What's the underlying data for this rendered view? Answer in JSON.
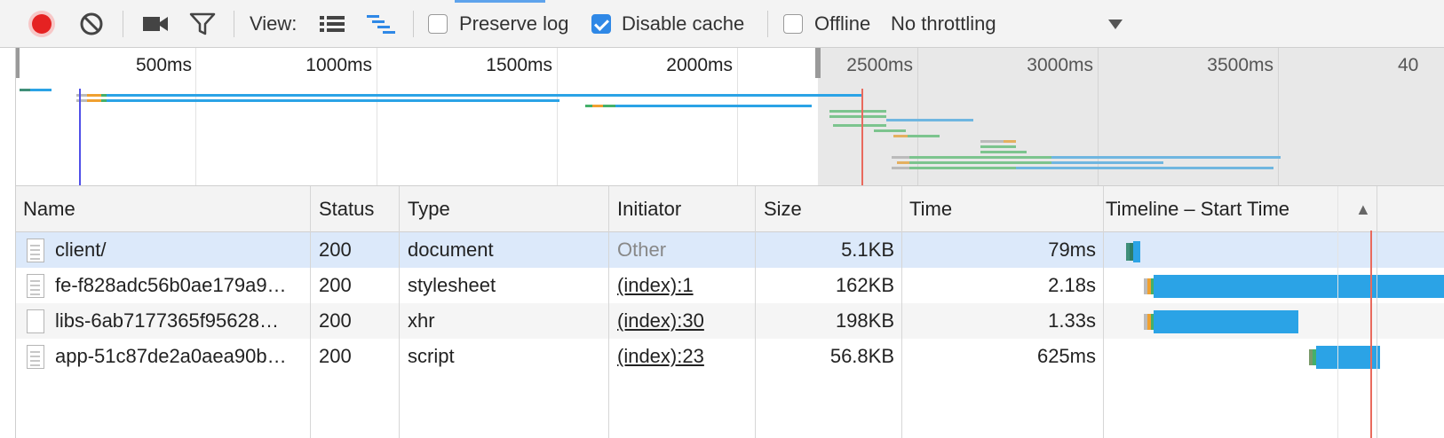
{
  "toolbar": {
    "record_icon": "record-icon",
    "clear_icon": "clear-icon",
    "view_label": "View:",
    "preserve_log_label": "Preserve log",
    "preserve_log_checked": false,
    "disable_cache_label": "Disable cache",
    "disable_cache_checked": true,
    "offline_label": "Offline",
    "offline_checked": false,
    "throttling_value": "No throttling"
  },
  "overview": {
    "ticks": [
      "500ms",
      "1000ms",
      "1500ms",
      "2000ms",
      "2500ms",
      "3000ms",
      "3500ms",
      "40"
    ]
  },
  "table": {
    "headers": {
      "name": "Name",
      "status": "Status",
      "type": "Type",
      "initiator": "Initiator",
      "size": "Size",
      "time": "Time",
      "timeline": "Timeline – Start Time",
      "sort_indicator": "▲"
    },
    "rows": [
      {
        "name": "client/",
        "status": "200",
        "type": "document",
        "initiator": "Other",
        "size": "5.1KB",
        "time": "79ms"
      },
      {
        "name": "fe-f828adc56b0ae179a9…",
        "status": "200",
        "type": "stylesheet",
        "initiator": "(index):1",
        "size": "162KB",
        "time": "2.18s"
      },
      {
        "name": "libs-6ab7177365f95628…",
        "status": "200",
        "type": "xhr",
        "initiator": "(index):30",
        "size": "198KB",
        "time": "1.33s"
      },
      {
        "name": "app-51c87de2a0aea90b…",
        "status": "200",
        "type": "script",
        "initiator": "(index):23",
        "size": "56.8KB",
        "time": "625ms"
      }
    ]
  },
  "colors": {
    "record": "#e52222",
    "accent": "#2f88e6",
    "download": "#2ba3e6",
    "waiting": "#44b06a",
    "connect": "#f0a030",
    "selected_row": "#dce9fa"
  }
}
